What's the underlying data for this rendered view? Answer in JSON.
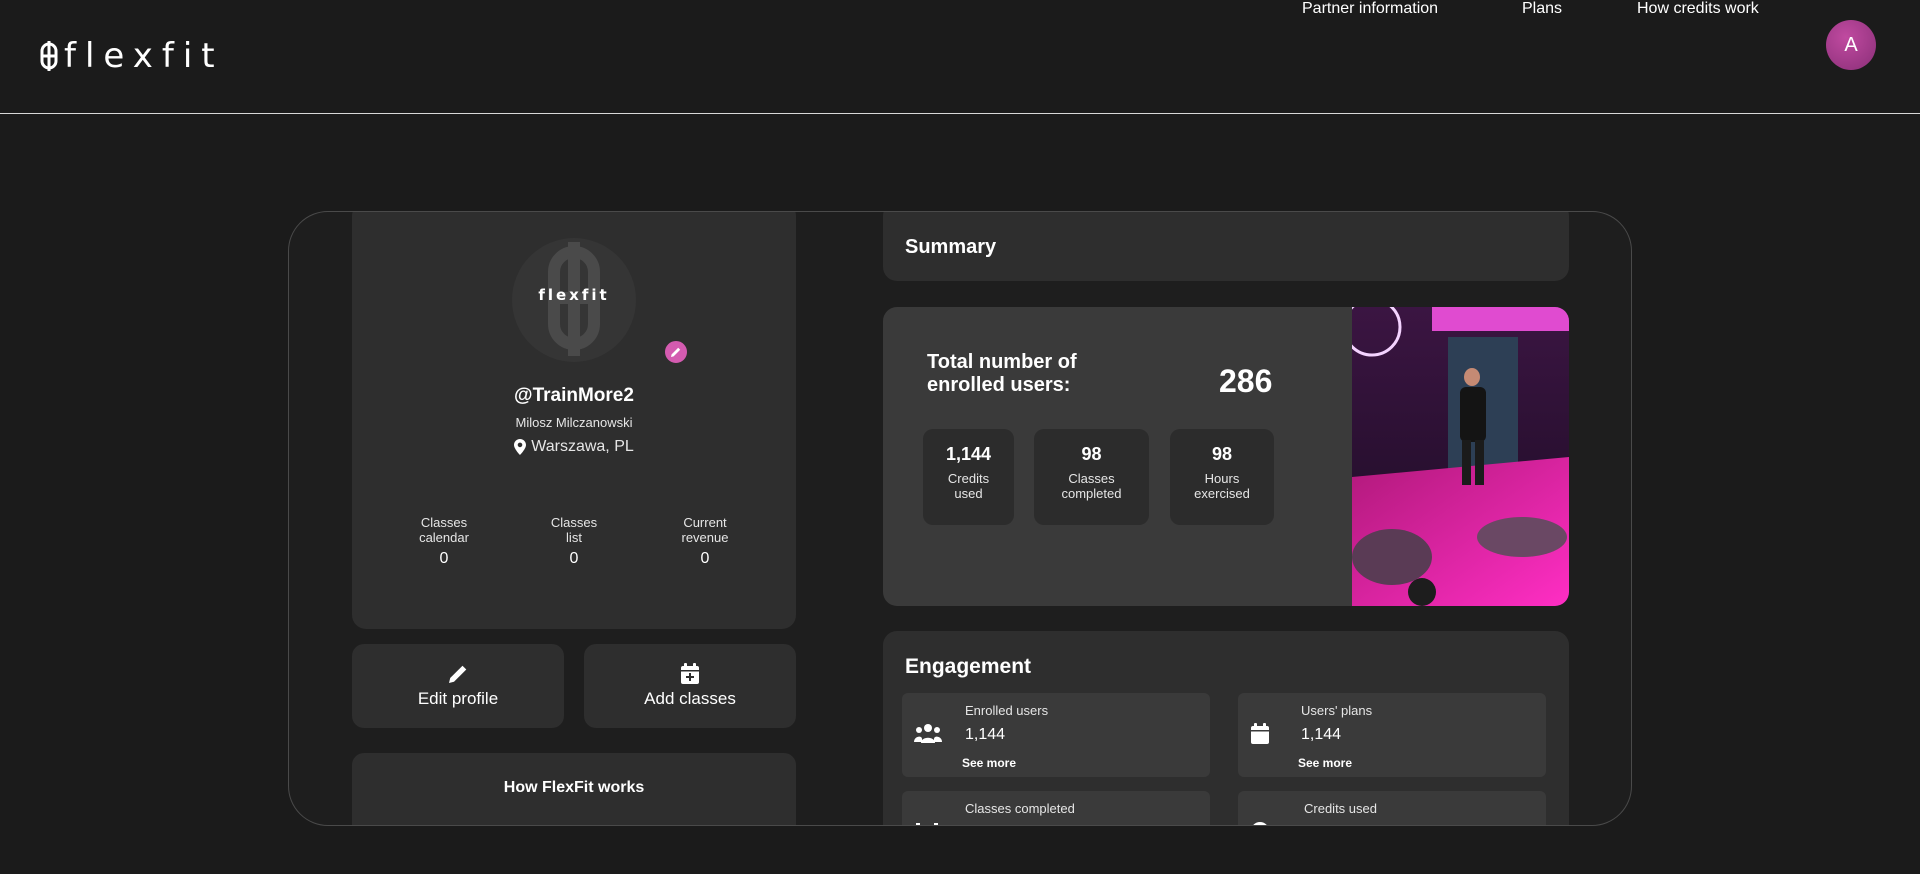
{
  "header": {
    "logo_text": "flexfit",
    "nav": [
      "Partner information",
      "Plans",
      "How credits work"
    ],
    "avatar_initial": "A"
  },
  "profile": {
    "picture_text": "flexfit",
    "handle": "@TrainMore2",
    "name": "Milosz Milczanowski",
    "location": "Warszawa, PL",
    "stats": [
      {
        "label_line1": "Classes",
        "label_line2": "calendar",
        "value": "0"
      },
      {
        "label_line1": "Classes",
        "label_line2": "list",
        "value": "0"
      },
      {
        "label_line1": "Current",
        "label_line2": "revenue",
        "value": "0"
      }
    ]
  },
  "actions": {
    "edit_profile": "Edit profile",
    "add_classes": "Add classes",
    "how_it_works": "How FlexFit works"
  },
  "summary": {
    "title": "Summary",
    "total_label_line1": "Total number of",
    "total_label_line2": "enrolled users:",
    "total_value": "286",
    "mini_stats": [
      {
        "value": "1,144",
        "line1": "Credits",
        "line2": "used"
      },
      {
        "value": "98",
        "line1": "Classes",
        "line2": "completed"
      },
      {
        "value": "98",
        "line1": "Hours",
        "line2": "exercised"
      }
    ]
  },
  "engagement": {
    "title": "Engagement",
    "items": [
      {
        "label": "Enrolled users",
        "value": "1,144",
        "more": "See more",
        "icon": "users-icon"
      },
      {
        "label": "Users' plans",
        "value": "1,144",
        "more": "See more",
        "icon": "calendar-icon"
      },
      {
        "label": "Classes completed",
        "value": "",
        "more": "",
        "icon": "dumbbell-icon"
      },
      {
        "label": "Credits used",
        "value": "",
        "more": "",
        "icon": "coin-icon"
      }
    ]
  },
  "colors": {
    "background": "#1b1b1b",
    "card": "#2e2e2e",
    "accent": "#d45bb0"
  }
}
